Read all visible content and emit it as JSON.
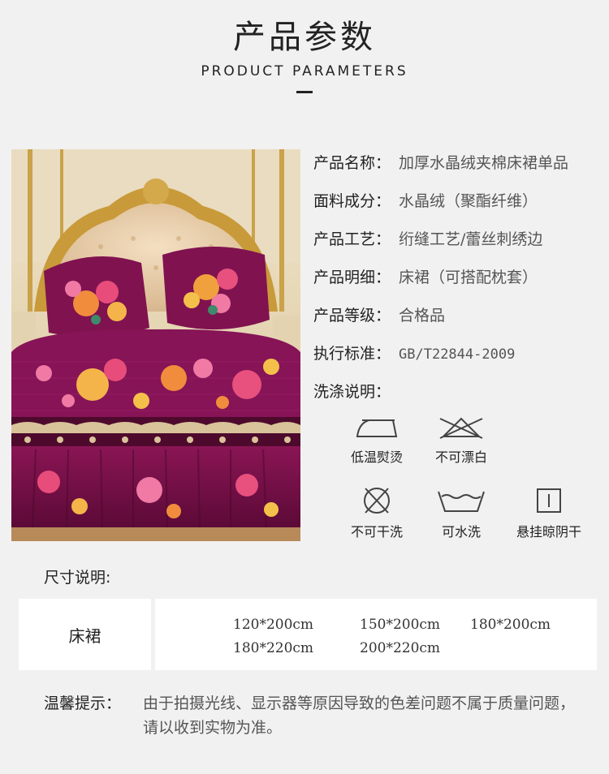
{
  "header": {
    "title_cn": "产品参数",
    "title_en": "PRODUCT PARAMETERS"
  },
  "params": [
    {
      "label": "产品名称：",
      "value": "加厚水晶绒夹棉床裙单品"
    },
    {
      "label": "面料成分：",
      "value": "水晶绒（聚酯纤维）"
    },
    {
      "label": "产品工艺：",
      "value": "绗缝工艺/蕾丝刺绣边"
    },
    {
      "label": "产品明细：",
      "value": "床裙（可搭配枕套）"
    },
    {
      "label": "产品等级：",
      "value": "合格品"
    },
    {
      "label": "执行标准：",
      "value": "GB/T22844-2009"
    },
    {
      "label": "洗涤说明：",
      "value": ""
    }
  ],
  "care": [
    {
      "icon": "iron-low-temp-icon",
      "label": "低温熨烫"
    },
    {
      "icon": "no-bleach-icon",
      "label": "不可漂白"
    },
    {
      "icon": "no-dry-clean-icon",
      "label": "不可干洗"
    },
    {
      "icon": "hand-wash-icon",
      "label": "可水洗"
    },
    {
      "icon": "line-dry-shade-icon",
      "label": "悬挂晾阴干"
    }
  ],
  "size": {
    "title": "尺寸说明:",
    "item": "床裙",
    "values": [
      "120*200cm",
      "150*200cm",
      "180*200cm",
      "180*220cm",
      "200*220cm"
    ]
  },
  "tip": {
    "label": "温馨提示：",
    "text": "由于拍摄光线、显示器等原因导致的色差问题不属于质量问题，请以收到实物为准。"
  },
  "colors": {
    "background": "#f2f1f1",
    "bed_purple": "#7a0f4a",
    "headboard_gold": "#c99a3a"
  }
}
